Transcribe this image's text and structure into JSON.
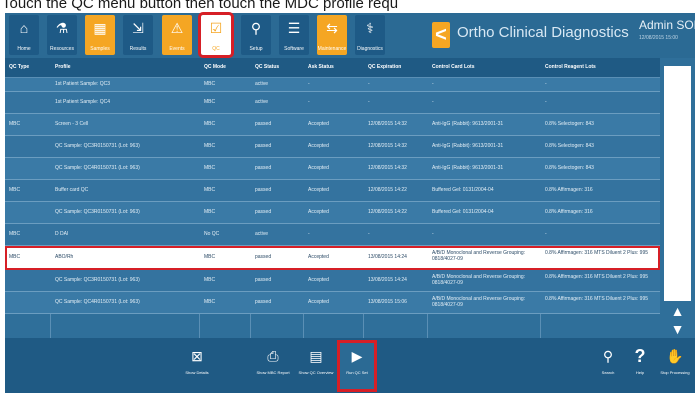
{
  "instruction": "Touch the QC menu button then touch the MDC profile requ",
  "toolbar": {
    "buttons": [
      {
        "label": "Home",
        "icon": "home-icon",
        "glyph": "⌂"
      },
      {
        "label": "Resources",
        "icon": "resources-icon",
        "glyph": "⚗"
      },
      {
        "label": "Samples",
        "icon": "samples-icon",
        "glyph": "▦"
      },
      {
        "label": "Results",
        "icon": "results-icon",
        "glyph": "⇲"
      },
      {
        "label": "Events",
        "icon": "events-icon",
        "glyph": "⚠"
      },
      {
        "label": "QC",
        "icon": "qc-icon",
        "glyph": "☑"
      },
      {
        "label": "Setup",
        "icon": "setup-icon",
        "glyph": "⚲"
      },
      {
        "label": "Software",
        "icon": "software-icon",
        "glyph": "☰"
      },
      {
        "label": "Maintenance",
        "icon": "maintenance-icon",
        "glyph": "⇆"
      },
      {
        "label": "Diagnostics",
        "icon": "diagnostics-icon",
        "glyph": "⚕"
      }
    ],
    "back_glyph": "<",
    "app_title": "Ortho Clinical Diagnostics",
    "user_name": "Admin SOL",
    "user_date": "12/08/2015 15:00"
  },
  "table": {
    "headers": [
      "QC Type",
      "Profile",
      "QC Mode",
      "QC Status",
      "Ask Status",
      "QC Expiration",
      "Control Card Lots",
      "Control Reagent Lots"
    ],
    "rows": [
      [
        "",
        "1st Patient Sample: QC3",
        "MBC",
        "active",
        "-",
        "-",
        "-",
        "-"
      ],
      [
        "",
        "1st Patient Sample: QC4",
        "MBC",
        "active",
        "-",
        "-",
        "-",
        "-"
      ],
      [
        "MBC",
        "Screen - 3 Cell",
        "MBC",
        "passed",
        "Accepted",
        "12/08/2015 14:32",
        "Anti-IgG (Rabbit): 9613/2001-31",
        "0.8% Selectogen: 843"
      ],
      [
        "",
        "QC Sample: QC3R0150731 (Lot: 963)",
        "MBC",
        "passed",
        "Accepted",
        "12/08/2015 14:32",
        "Anti-IgG (Rabbit): 9613/2001-31",
        "0.8% Selectogen: 843"
      ],
      [
        "",
        "QC Sample: QC4R0150731 (Lot: 963)",
        "MBC",
        "passed",
        "Accepted",
        "12/08/2015 14:32",
        "Anti-IgG (Rabbit): 9613/2001-31",
        "0.8% Selectogen: 843"
      ],
      [
        "MBC",
        "Buffer card QC",
        "MBC",
        "passed",
        "Accepted",
        "12/08/2015 14:22",
        "Buffered Gel: 0131/2004-04",
        "0.8% Affirmagen: 316"
      ],
      [
        "",
        "QC Sample: QC3R0150731 (Lot: 963)",
        "MBC",
        "passed",
        "Accepted",
        "12/08/2015 14:22",
        "Buffered Gel: 0131/2004-04",
        "0.8% Affirmagen: 316"
      ],
      [
        "MBC",
        "D DAI",
        "No QC",
        "active",
        "-",
        "-",
        "-",
        "-"
      ],
      [
        "MBC",
        "ABO/Rh",
        "MBC",
        "passed",
        "Accepted",
        "13/08/2015 14:24",
        "A/B/D Monoclonal and Reverse Grouping: 0818/4027-09",
        "0.8% Affirmagen: 316 MTS Diluent 2 Plus: 995"
      ],
      [
        "",
        "QC Sample: QC3R0150731 (Lot: 963)",
        "MBC",
        "passed",
        "Accepted",
        "13/08/2015 14:24",
        "A/B/D Monoclonal and Reverse Grouping: 0818/4027-09",
        "0.8% Affirmagen: 316 MTS Diluent 2 Plus: 995"
      ],
      [
        "",
        "QC Sample: QC4R0150731 (Lot: 963)",
        "MBC",
        "passed",
        "Accepted",
        "13/08/2015 15:06",
        "A/B/D Monoclonal and Reverse Grouping: 0818/4027-09",
        "0.8% Affirmagen: 316 MTS Diluent 2 Plus: 995"
      ]
    ]
  },
  "bottombar": {
    "buttons": [
      {
        "label": "Show Details",
        "icon": "details-icon",
        "glyph": "⊠"
      },
      {
        "label": "Show MBC Report",
        "icon": "report-icon",
        "glyph": "⎙"
      },
      {
        "label": "Show QC Overview",
        "icon": "overview-icon",
        "glyph": "▤"
      },
      {
        "label": "Run QC Set",
        "icon": "play-icon",
        "glyph": "▶"
      },
      {
        "label": "Search",
        "icon": "search-icon",
        "glyph": "⚲"
      },
      {
        "label": "Help",
        "icon": "help-icon",
        "glyph": "?"
      },
      {
        "label": "Stop Processing",
        "icon": "stop-hand-icon",
        "glyph": "✋"
      }
    ]
  },
  "colors": {
    "accent": "#f5a623",
    "highlight": "#d61f26",
    "primary": "#2b6a94"
  }
}
